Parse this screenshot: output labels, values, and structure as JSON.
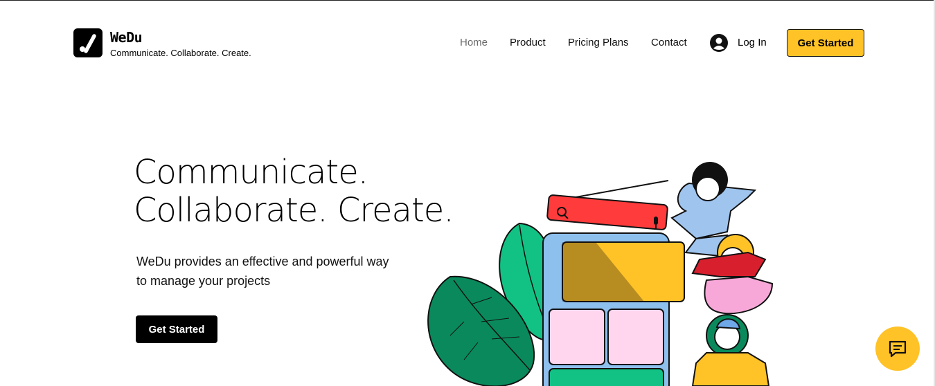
{
  "brand": {
    "name": "WeDu",
    "tagline": "Communicate. Collaborate. Create."
  },
  "nav": {
    "items": [
      {
        "label": "Home",
        "active": true
      },
      {
        "label": "Product",
        "active": false
      },
      {
        "label": "Pricing Plans",
        "active": false
      },
      {
        "label": "Contact",
        "active": false
      }
    ],
    "login_label": "Log In",
    "cta_label": "Get Started"
  },
  "hero": {
    "title_line1": "Communicate.",
    "title_line2": "Collaborate. Create.",
    "description": "WeDu provides an effective and powerful way to manage your projects",
    "cta_label": "Get Started"
  },
  "icons": {
    "logo": "slash-dot-logo-icon",
    "login": "user-avatar-icon",
    "chat": "chat-bubble-icon",
    "search": "search-icon",
    "mic": "microphone-icon"
  },
  "colors": {
    "accent": "#ffc227",
    "primary_button": "#000000",
    "nav_active": "#6b6b6b"
  }
}
